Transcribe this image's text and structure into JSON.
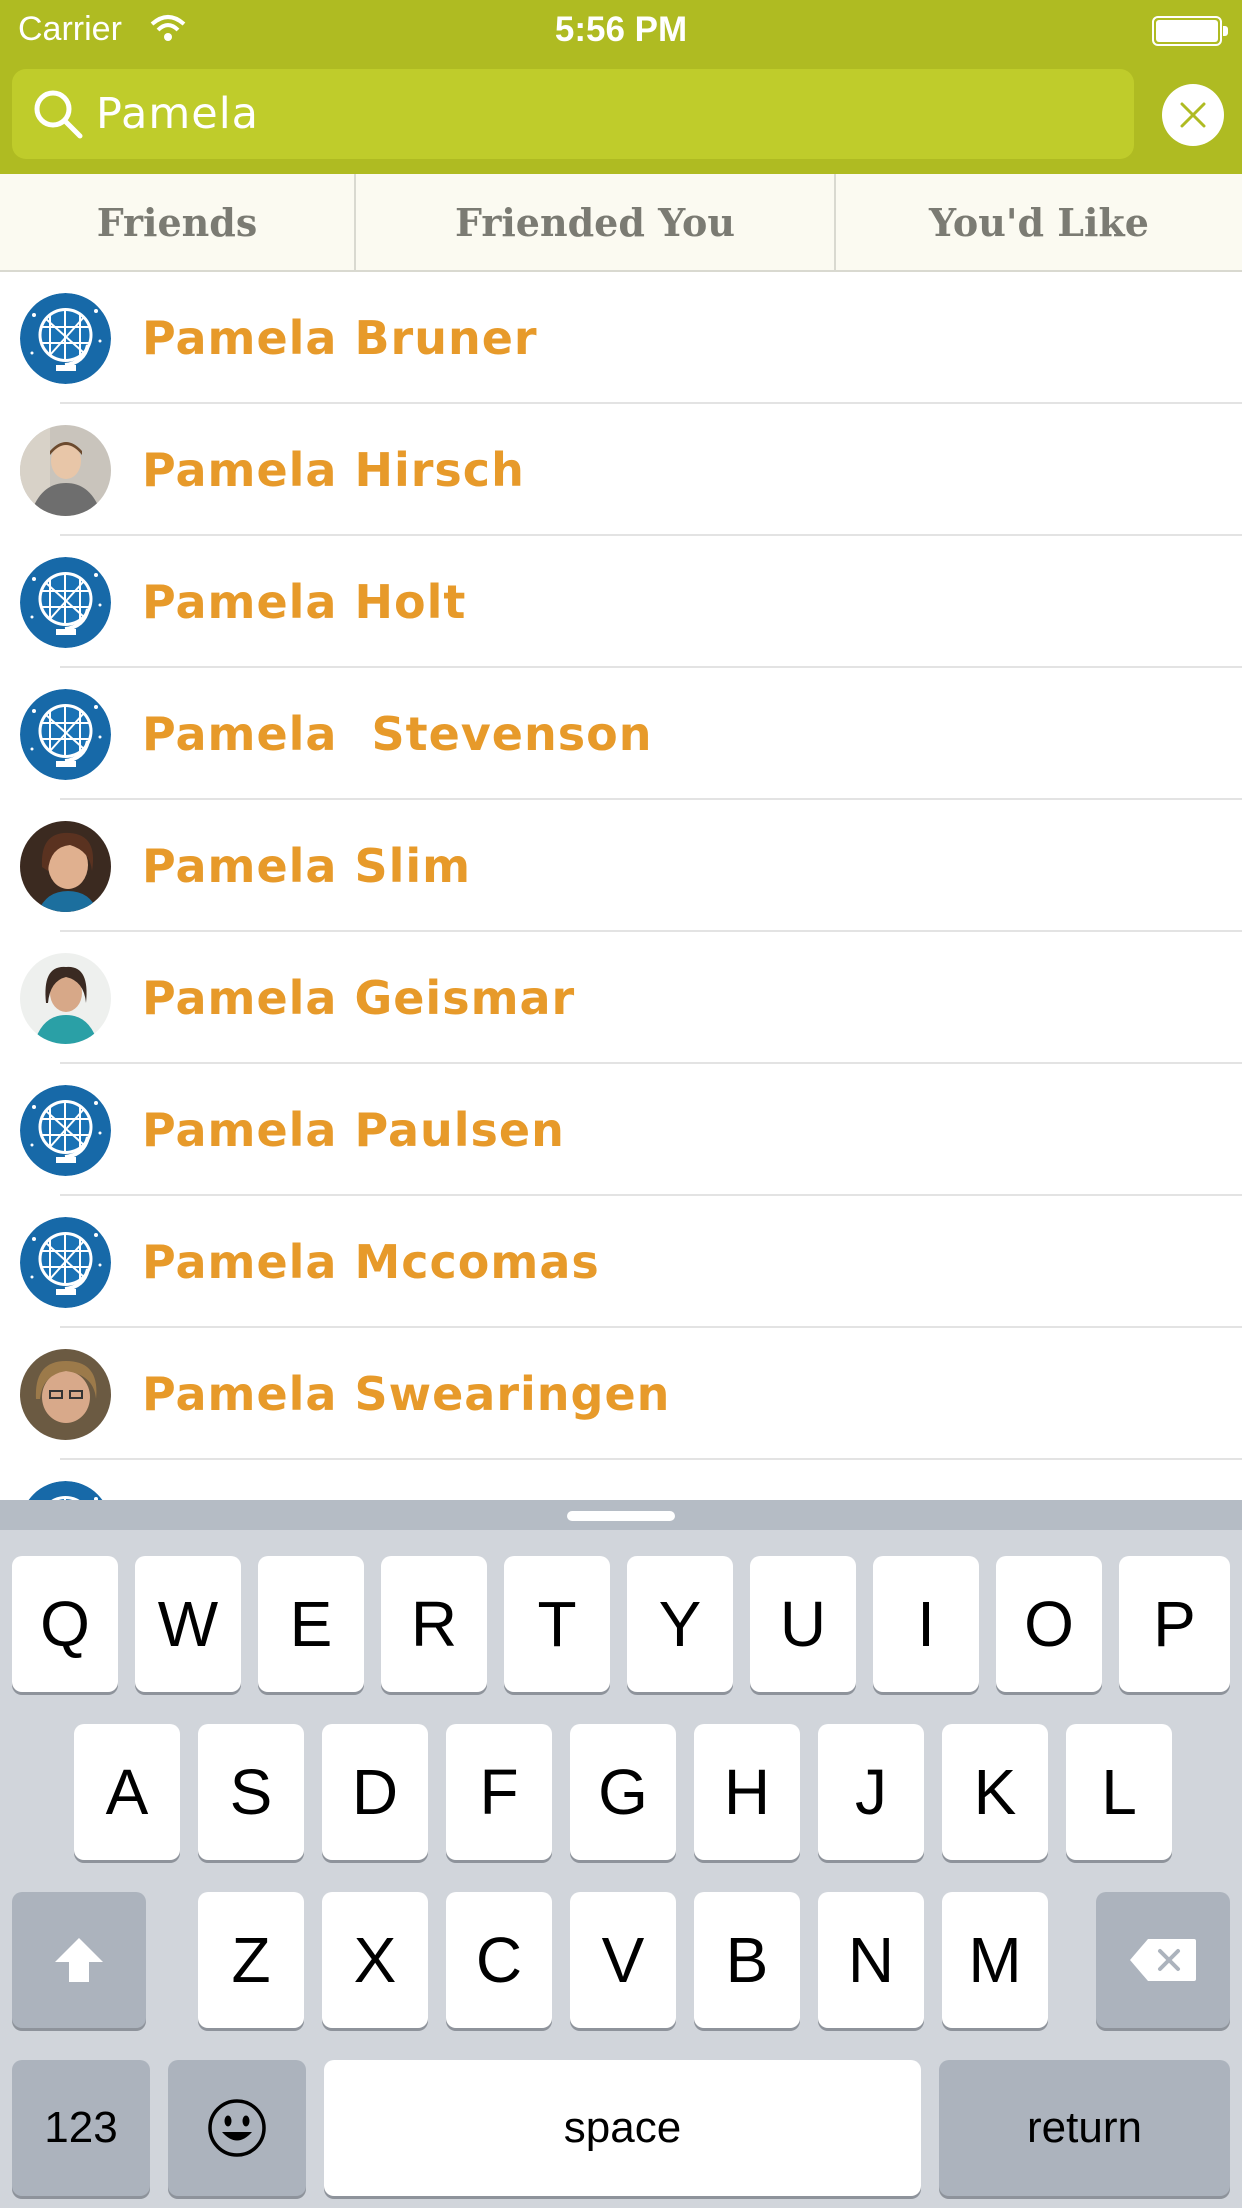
{
  "status_bar": {
    "carrier": "Carrier",
    "time": "5:56 PM"
  },
  "search": {
    "value": "Pamela"
  },
  "tabs": [
    {
      "label": "Friends"
    },
    {
      "label": "Friended You"
    },
    {
      "label": "You'd Like"
    }
  ],
  "results": [
    {
      "name": "Pamela Bruner",
      "avatar": "globe-icon"
    },
    {
      "name": "Pamela Hirsch",
      "avatar": "photo"
    },
    {
      "name": "Pamela Holt",
      "avatar": "globe-icon"
    },
    {
      "name": "Pamela  Stevenson",
      "avatar": "globe-icon"
    },
    {
      "name": "Pamela Slim",
      "avatar": "photo"
    },
    {
      "name": "Pamela Geismar",
      "avatar": "photo"
    },
    {
      "name": "Pamela Paulsen",
      "avatar": "globe-icon"
    },
    {
      "name": "Pamela Mccomas",
      "avatar": "globe-icon"
    },
    {
      "name": "Pamela Swearingen",
      "avatar": "photo"
    },
    {
      "name": "",
      "avatar": "globe-icon"
    }
  ],
  "keyboard": {
    "row1": [
      "Q",
      "W",
      "E",
      "R",
      "T",
      "Y",
      "U",
      "I",
      "O",
      "P"
    ],
    "row2": [
      "A",
      "S",
      "D",
      "F",
      "G",
      "H",
      "J",
      "K",
      "L"
    ],
    "row3": [
      "Z",
      "X",
      "C",
      "V",
      "B",
      "N",
      "M"
    ],
    "numbers_label": "123",
    "space_label": "space",
    "return_label": "return"
  },
  "colors": {
    "header": "#afbb22",
    "search_field": "#bfcc2b",
    "name_text": "#e79a2a",
    "globe_blue": "#1769a8"
  }
}
